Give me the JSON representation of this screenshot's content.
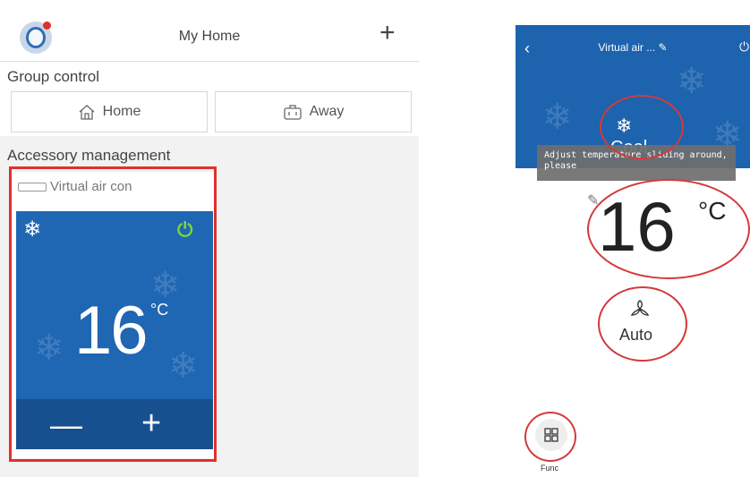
{
  "left_screen": {
    "header": {
      "title": "My Home",
      "add_label": "+"
    },
    "group_control": {
      "label": "Group control",
      "home_label": "Home",
      "away_label": "Away"
    },
    "accessory": {
      "label": "Accessory management",
      "device_name": "Virtual air con",
      "temperature": "16",
      "unit": "°C",
      "minus_label": "—",
      "plus_label": "+"
    }
  },
  "right_screen": {
    "title": "Virtual air ...",
    "mode": "Cool",
    "tooltip": "Adjust temperature sliding around, please",
    "temperature": "16",
    "unit": "°C",
    "fan_mode": "Auto",
    "func_label": "Func"
  },
  "colors": {
    "panel_blue": "#1f66b3",
    "panel_blue_dark": "#17508f",
    "power_green": "#7bd43c",
    "annotation_red": "#e0312c"
  }
}
